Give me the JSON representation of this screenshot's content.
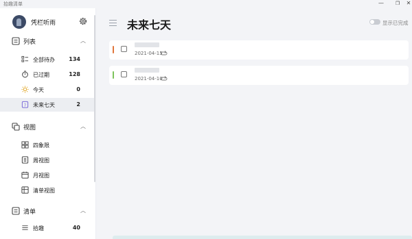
{
  "window": {
    "title": "拾趣清单",
    "min": "—",
    "max": "❐",
    "close": "✕"
  },
  "sidebar": {
    "user": {
      "name": "凭栏听雨"
    },
    "sections": [
      {
        "label": "列表",
        "icon": "list-icon",
        "items": [
          {
            "label": "全部待办",
            "count": "134",
            "icon": "all-tasks-icon"
          },
          {
            "label": "已过期",
            "count": "128",
            "icon": "overdue-icon"
          },
          {
            "label": "今天",
            "count": "0",
            "icon": "sun-icon"
          },
          {
            "label": "未来七天",
            "count": "2",
            "icon": "calendar-7-icon",
            "active": true
          }
        ]
      },
      {
        "label": "视图",
        "icon": "views-icon",
        "items": [
          {
            "label": "四象限",
            "icon": "quadrant-icon"
          },
          {
            "label": "周视图",
            "icon": "week-view-icon"
          },
          {
            "label": "月视图",
            "icon": "month-view-icon"
          },
          {
            "label": "清单视图",
            "icon": "list-view-icon"
          }
        ]
      },
      {
        "label": "清单",
        "icon": "checklist-icon",
        "items": [
          {
            "label": "拾趣",
            "count": "40",
            "icon": "menu-lines-icon"
          }
        ]
      }
    ]
  },
  "main": {
    "title": "未来七天",
    "show_completed_label": "显示已完成",
    "show_completed": false,
    "tasks": [
      {
        "date": "2021-04-15",
        "priority_color": "#e0753a"
      },
      {
        "date": "2021-04-10",
        "priority_color": "#7cc35b"
      }
    ]
  },
  "colors": {
    "sidebar_bg": "#ffffff",
    "main_bg": "#f3f4f7",
    "active_item_bg": "#eceef2"
  }
}
